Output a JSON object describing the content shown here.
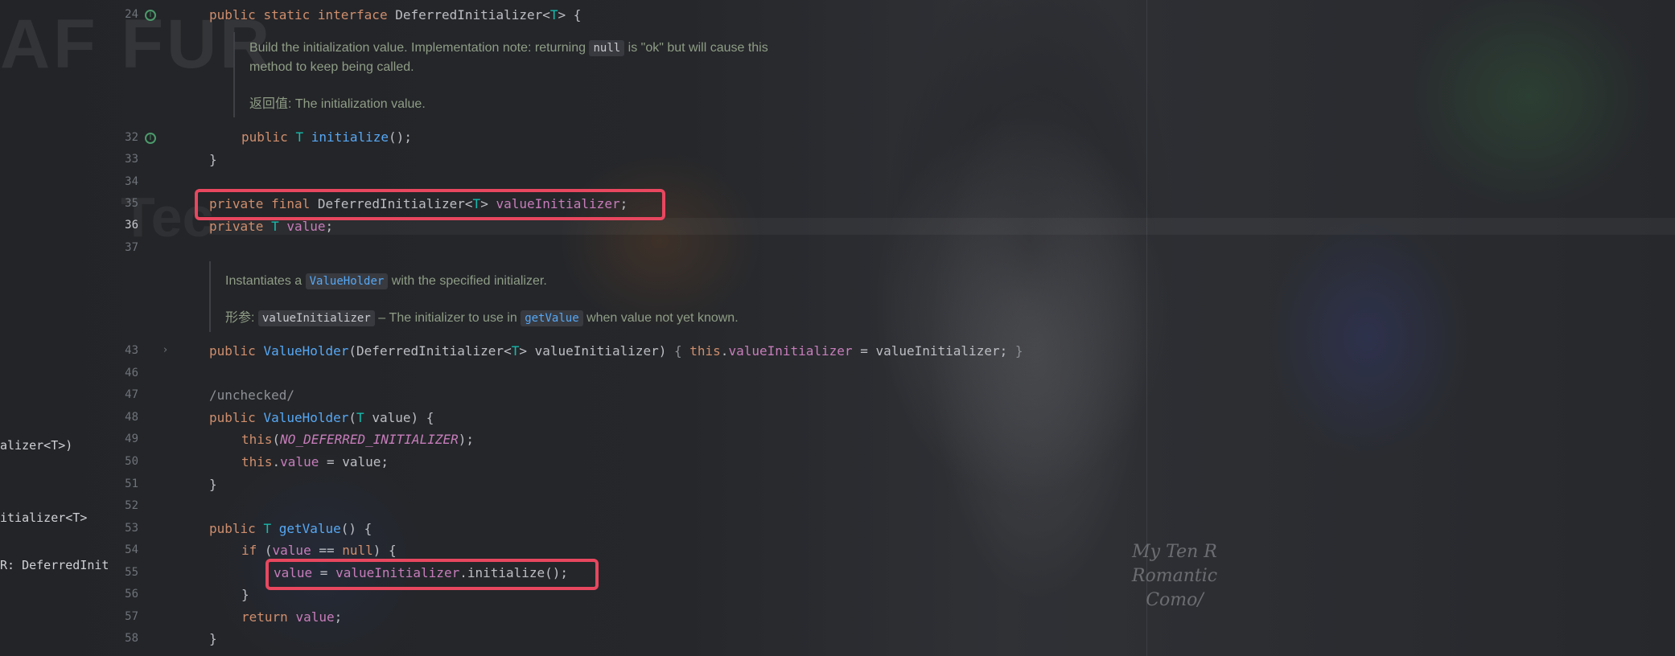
{
  "left_panel": {
    "items": [
      "alizer<T>)",
      "itializer<T>",
      "R: DeferredInitialize"
    ]
  },
  "background": {
    "wall_text": "AF FUR",
    "wall_text_2": "Tec",
    "shirt_text": "My Ten R\nRomantic\nComo/"
  },
  "gutter": {
    "line_numbers": [
      "24",
      "32",
      "33",
      "34",
      "35",
      "36",
      "37",
      "43",
      "46",
      "47",
      "48",
      "49",
      "50",
      "51",
      "52",
      "53",
      "54",
      "55",
      "56",
      "57",
      "58"
    ],
    "current_line": "36",
    "implement_marker": "I"
  },
  "code": {
    "l24": {
      "public": "public",
      "static": "static",
      "interface": "interface",
      "name": " DeferredInitializer<",
      "T": "T",
      "end": "> {"
    },
    "doc1": {
      "p1a": "Build the initialization value. Implementation note: returning ",
      "p1chip": "null",
      "p1b": " is \"ok\" but will cause this",
      "p2": "method to keep being called.",
      "returns_label": "返回值:",
      "returns_text": " The initialization value."
    },
    "l32": {
      "public": "public",
      "T": "T",
      "name": "initialize",
      "end": "();"
    },
    "l33": "}",
    "l35": {
      "private": "private",
      "final": "final",
      "type": " DeferredInitializer<",
      "T": "T",
      "gt": "> ",
      "field": "valueInitializer",
      "end": ";"
    },
    "l36": {
      "private": "private",
      "T": "T",
      "field": "value",
      "end": ";"
    },
    "doc2": {
      "a": "Instantiates a ",
      "chip1": "ValueHolder",
      "b": " with the specified initializer.",
      "params_label": "形参:",
      "chip2": "valueInitializer",
      "c": " – The initializer to use in ",
      "chip3": "getValue",
      "d": " when value not yet known."
    },
    "l43": {
      "public": "public",
      "name": "ValueHolder",
      "p1": "(DeferredInitializer<",
      "T": "T",
      "p2": "> valueInitializer) ",
      "b1": "{ ",
      "this": "this",
      ".": ".",
      "field": "valueInitializer",
      "p3": " = valueInitializer; ",
      "b2": "}"
    },
    "l47": "/unchecked/",
    "l48": {
      "public": "public",
      "name": "ValueHolder",
      "p1": "(",
      "T": "T",
      "p2": " value) {"
    },
    "l49": {
      "this": "this",
      "p1": "(",
      "const": "NO_DEFERRED_INITIALIZER",
      "p2": ");"
    },
    "l50": {
      "this": "this",
      "dot": ".",
      "field": "value",
      "rest": " = value;"
    },
    "l51": "}",
    "l53": {
      "public": "public",
      "T": "T",
      "name": "getValue",
      "end": "() {"
    },
    "l54": {
      "if": "if",
      "p1": " (",
      "field": "value",
      "p2": " == ",
      "null": "null",
      "p3": ") {"
    },
    "l55": {
      "field": "value",
      "eq": " = ",
      "field2": "valueInitializer",
      "rest": ".initialize();"
    },
    "l56": "}",
    "l57": {
      "return": "return",
      "field": "value",
      "end": ";"
    },
    "l58": "}"
  },
  "colors": {
    "keyword": "#cf8e6d",
    "type_param": "#16baac",
    "method": "#56a8f5",
    "field": "#c77dbb",
    "doc": "#8f9d86",
    "highlight_box": "#e8475f"
  }
}
